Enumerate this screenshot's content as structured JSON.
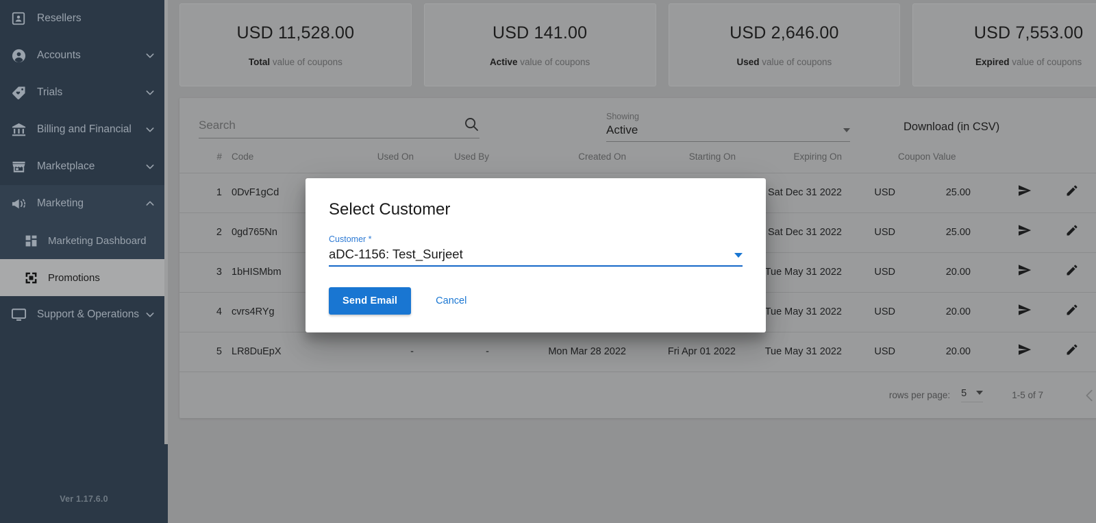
{
  "sidebar": {
    "items": [
      {
        "label": "Resellers",
        "icon": "resellers-badge-icon",
        "expandable": false,
        "state": ""
      },
      {
        "label": "Accounts",
        "icon": "account-circle-icon",
        "expandable": true,
        "state": "collapsed"
      },
      {
        "label": "Trials",
        "icon": "tag-heart-icon",
        "expandable": true,
        "state": "collapsed"
      },
      {
        "label": "Billing and Financial",
        "icon": "bank-icon",
        "expandable": true,
        "state": "collapsed"
      },
      {
        "label": "Marketplace",
        "icon": "storefront-icon",
        "expandable": true,
        "state": "collapsed"
      },
      {
        "label": "Marketing",
        "icon": "megaphone-icon",
        "expandable": true,
        "state": "expanded"
      },
      {
        "label": "Marketing Dashboard",
        "icon": "dashboard-grid-icon",
        "expandable": false,
        "state": "sub"
      },
      {
        "label": "Promotions",
        "icon": "promotions-icon",
        "expandable": false,
        "state": "sub-active"
      },
      {
        "label": "Support & Operations",
        "icon": "monitor-icon",
        "expandable": true,
        "state": "collapsed"
      }
    ],
    "version": "Ver 1.17.6.0"
  },
  "cards": [
    {
      "amount": "USD 11,528.00",
      "emphasis": "Total",
      "suffix": " value of coupons"
    },
    {
      "amount": "USD 141.00",
      "emphasis": "Active",
      "suffix": " value of coupons"
    },
    {
      "amount": "USD 2,646.00",
      "emphasis": "Used",
      "suffix": " value of coupons"
    },
    {
      "amount": "USD 7,553.00",
      "emphasis": "Expired",
      "suffix": " value of coupons"
    }
  ],
  "toolbar": {
    "search_placeholder": "Search",
    "search_value": "",
    "search_icon": "search-icon",
    "showing_label": "Showing",
    "showing_value": "Active",
    "download_label": "Download (in CSV)"
  },
  "table": {
    "headers": [
      "#",
      "Code",
      "Used On",
      "Used By",
      "Created On",
      "Starting On",
      "Expiring On",
      "Coupon Value"
    ],
    "rows": [
      {
        "num": "1",
        "code": "0DvF1gCd",
        "used_on": "-",
        "used_by": "-",
        "created_on": "",
        "starting_on": "",
        "expiring_on": "Sat Dec 31 2022",
        "currency": "USD",
        "value": "25.00",
        "send_icon": "send-icon",
        "edit_icon": "pencil-icon",
        "toggle": "on"
      },
      {
        "num": "2",
        "code": "0gd765Nn",
        "used_on": "-",
        "used_by": "-",
        "created_on": "",
        "starting_on": "",
        "expiring_on": "Sat Dec 31 2022",
        "currency": "USD",
        "value": "25.00",
        "send_icon": "send-icon",
        "edit_icon": "pencil-icon",
        "toggle": "on"
      },
      {
        "num": "3",
        "code": "1bHISMbm",
        "used_on": "-",
        "used_by": "-",
        "created_on": "",
        "starting_on": "",
        "expiring_on": "Tue May 31 2022",
        "currency": "USD",
        "value": "20.00",
        "send_icon": "send-icon",
        "edit_icon": "pencil-icon",
        "toggle": "on"
      },
      {
        "num": "4",
        "code": "cvrs4RYg",
        "used_on": "-",
        "used_by": "-",
        "created_on": "",
        "starting_on": "",
        "expiring_on": "Tue May 31 2022",
        "currency": "USD",
        "value": "20.00",
        "send_icon": "send-icon",
        "edit_icon": "pencil-icon",
        "toggle": "on"
      },
      {
        "num": "5",
        "code": "LR8DuEpX",
        "used_on": "-",
        "used_by": "-",
        "created_on": "Mon Mar 28 2022",
        "starting_on": "Fri Apr 01 2022",
        "expiring_on": "Tue May 31 2022",
        "currency": "USD",
        "value": "20.00",
        "send_icon": "send-icon",
        "edit_icon": "pencil-icon",
        "toggle": "on"
      }
    ]
  },
  "pagination": {
    "rows_per_page_label": "rows per page:",
    "rows_per_page_value": "5",
    "range_label": "1-5 of 7",
    "prev_icon": "chevron-left-icon",
    "next_icon": "chevron-right-icon"
  },
  "modal": {
    "title": "Select Customer",
    "field_label": "Customer",
    "field_required_mark": "*",
    "field_value": "aDC-1156: Test_Surjeet",
    "submit_label": "Send Email",
    "cancel_label": "Cancel"
  },
  "colors": {
    "sidebar_bg": "#2b3846",
    "sidebar_active_bg": "#a8a9aa",
    "page_bg": "#919293",
    "panel_bg": "#9a9b9c",
    "accent_blue": "#1976d2",
    "toggle_on": "#5b7fbe"
  }
}
